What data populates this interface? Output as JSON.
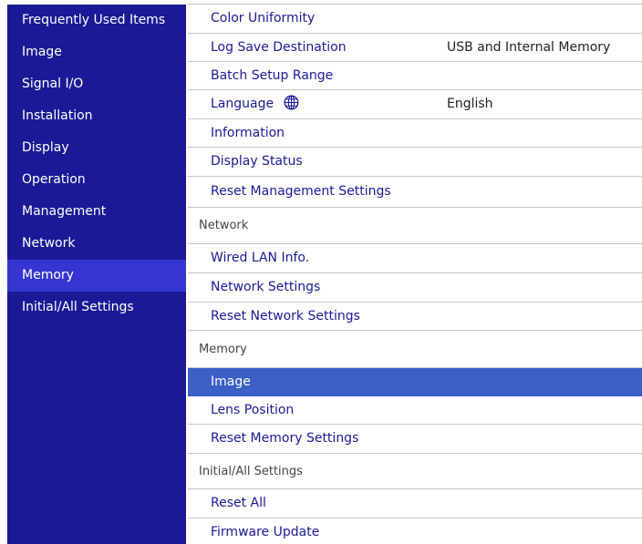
{
  "sidebar": {
    "items": [
      {
        "label": "Frequently Used Items"
      },
      {
        "label": "Image"
      },
      {
        "label": "Signal I/O"
      },
      {
        "label": "Installation"
      },
      {
        "label": "Display"
      },
      {
        "label": "Operation"
      },
      {
        "label": "Management"
      },
      {
        "label": "Network"
      },
      {
        "label": "Memory"
      },
      {
        "label": "Initial/All Settings"
      }
    ],
    "selected_item": "Memory"
  },
  "content": {
    "rows": [
      {
        "label": "Color Uniformity",
        "value": ""
      },
      {
        "label": "Log Save Destination",
        "value": "USB and Internal Memory"
      },
      {
        "label": "Batch Setup Range",
        "value": ""
      },
      {
        "label": "Language",
        "value": "English",
        "icon": "globe-icon"
      },
      {
        "label": "Information",
        "value": ""
      },
      {
        "label": "Display Status",
        "value": ""
      },
      {
        "label": "Reset Management Settings",
        "value": ""
      },
      {
        "label": "Network",
        "section": true
      },
      {
        "label": "Wired LAN Info.",
        "value": ""
      },
      {
        "label": "Network Settings",
        "value": ""
      },
      {
        "label": "Reset Network Settings",
        "value": ""
      },
      {
        "label": "Memory",
        "section": true
      },
      {
        "label": "Image",
        "value": "",
        "selected": true
      },
      {
        "label": "Lens Position",
        "value": ""
      },
      {
        "label": "Reset Memory Settings",
        "value": ""
      },
      {
        "label": "Initial/All Settings",
        "section": true
      },
      {
        "label": "Reset All",
        "value": ""
      },
      {
        "label": "Firmware Update",
        "value": ""
      }
    ]
  },
  "colors": {
    "sidebar_bg": "#1a1a96",
    "sidebar_selected": "#3535d2",
    "row_selected": "#3a5fc7",
    "label_text": "#1a1a96"
  }
}
